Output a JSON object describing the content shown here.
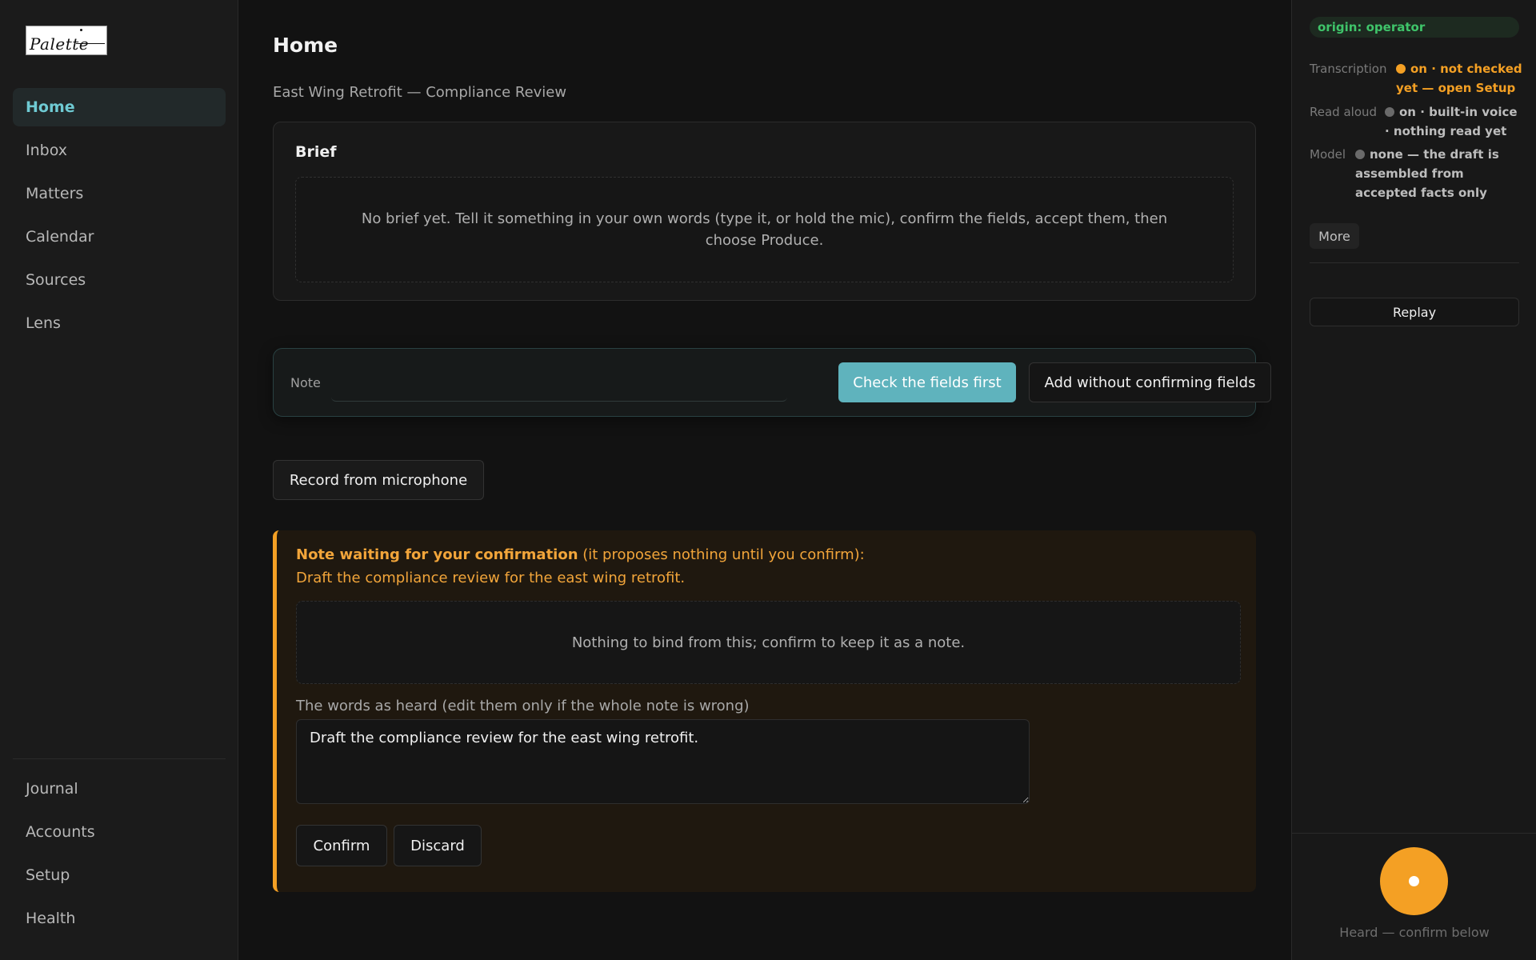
{
  "app": {
    "logo_text": "Palette"
  },
  "sidebar": {
    "top_items": [
      {
        "label": "Home",
        "active": true
      },
      {
        "label": "Inbox"
      },
      {
        "label": "Matters"
      },
      {
        "label": "Calendar"
      },
      {
        "label": "Sources"
      },
      {
        "label": "Lens"
      }
    ],
    "bottom_items": [
      {
        "label": "Journal"
      },
      {
        "label": "Accounts"
      },
      {
        "label": "Setup"
      },
      {
        "label": "Health"
      }
    ]
  },
  "main": {
    "title": "Home",
    "subtitle": "East Wing Retrofit — Compliance Review",
    "brief": {
      "title": "Brief",
      "empty_text": "No brief yet. Tell it something in your own words (type it, or hold the mic), confirm the fields, accept them, then choose Produce."
    },
    "note_bar": {
      "label": "Note",
      "input_value": "",
      "input_placeholder": "",
      "primary_button": "Check the fields first",
      "secondary_button": "Add without confirming fields"
    },
    "mic_button": "Record from microphone",
    "pending_note": {
      "head_bold": "Note waiting for your confirmation",
      "head_rest": " (it proposes nothing until you confirm):",
      "note_text": "Draft the compliance review for the east wing retrofit.",
      "empty_text": "Nothing to bind from this; confirm to keep it as a note.",
      "heard_label": "The words as heard (edit them only if the whole note is wrong)",
      "heard_value": "Draft the compliance review for the east wing retrofit.",
      "confirm_button": "Confirm",
      "discard_button": "Discard"
    }
  },
  "right_panel": {
    "origin_badge": "origin: operator",
    "status": [
      {
        "key": "Transcription",
        "value": "on · not checked yet — open Setup",
        "dot": "orange"
      },
      {
        "key": "Read aloud",
        "value": "on · built-in voice · nothing read yet",
        "dot": "grey"
      },
      {
        "key": "Model",
        "value": "none — the draft is assembled from accepted facts only",
        "dot": "grey"
      }
    ],
    "more_button": "More",
    "replay_button": "Replay",
    "heard_status": "Heard — confirm below"
  },
  "colors": {
    "accent_teal": "#5fb3bd",
    "warning_orange": "#f4a024",
    "success_green": "#3fc46a",
    "background": "#121212"
  },
  "icons": {
    "logo": "palette-logo",
    "mic_orb": "microphone-record-icon",
    "status_dot": "status-dot-icon"
  }
}
